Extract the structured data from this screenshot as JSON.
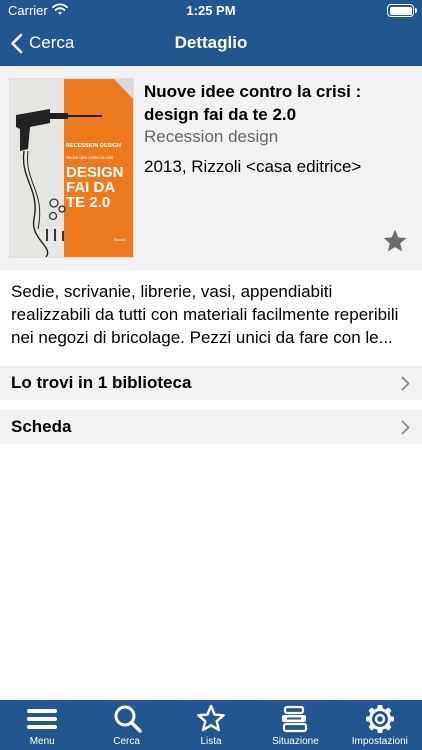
{
  "status_bar": {
    "carrier": "Carrier",
    "time": "1:25 PM",
    "wifi_icon": "wifi-icon",
    "battery_icon": "battery-icon"
  },
  "nav": {
    "back_label": "Cerca",
    "title": "Dettaglio",
    "background": "#21568f"
  },
  "book": {
    "title": "Nuove idee contro la crisi : design fai da te 2.0",
    "subtitle": "Recession design",
    "publication": "2013, Rizzoli <casa editrice>",
    "favorite_icon": "star-icon",
    "cover": {
      "series_band": "RECESSION DESIGN",
      "tagline": "Nuove idee contro la crisi",
      "main_title_line1": "DESIGN",
      "main_title_line2": "FAI DA",
      "main_title_line3": "TE 2.0",
      "publisher": "Rizzoli",
      "accent_color": "#ee7a1f"
    }
  },
  "description": "Sedie, scrivanie, librerie, vasi, appendiabiti realizzabili da tutti con materiali facilmente reperibili nei negozi di bricolage. Pezzi unici da fare con le...",
  "rows": [
    {
      "label": "Lo trovi in 1 biblioteca"
    },
    {
      "label": "Scheda"
    }
  ],
  "tabs": [
    {
      "label": "Menu",
      "icon": "menu-icon"
    },
    {
      "label": "Cerca",
      "icon": "search-icon"
    },
    {
      "label": "Lista",
      "icon": "star-icon"
    },
    {
      "label": "Situazione",
      "icon": "books-icon"
    },
    {
      "label": "Impostazioni",
      "icon": "gear-icon"
    }
  ]
}
